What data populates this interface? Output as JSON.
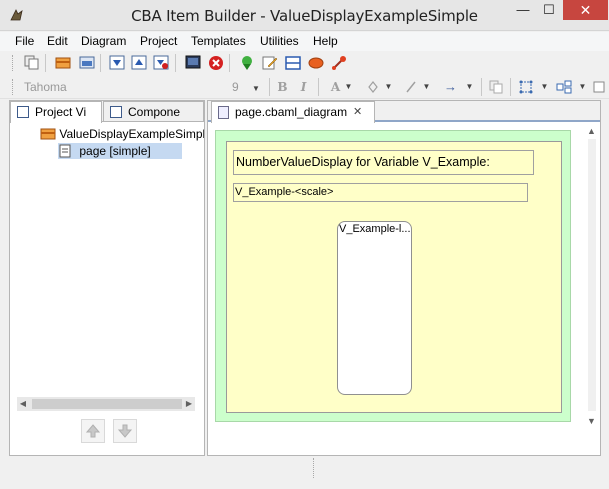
{
  "window": {
    "title": "CBA Item Builder - ValueDisplayExampleSimple",
    "minimize": "—",
    "maximize": "☐",
    "close": "✕"
  },
  "menu": {
    "items": [
      "File",
      "Edit",
      "Diagram",
      "Project",
      "Templates",
      "Utilities",
      "Help"
    ]
  },
  "format_toolbar": {
    "font_family": "Tahoma",
    "font_size": "9",
    "bold": "B",
    "italic": "I",
    "font_color": "A",
    "arrow": "→"
  },
  "left_panel": {
    "tabs": [
      {
        "label": "Project Vi",
        "active": true
      },
      {
        "label": "Compone",
        "active": false
      }
    ],
    "tree": [
      {
        "label": "ValueDisplayExampleSimple",
        "level": 0,
        "selected": false
      },
      {
        "label": "page [simple]",
        "level": 1,
        "selected": true
      }
    ]
  },
  "editor": {
    "tab_label": "page.cbaml_diagram",
    "tab_close": "✕",
    "diagram": {
      "title_text": "NumberValueDisplay for Variable V_Example:",
      "scale_text": "V_Example-<scale>",
      "display_text": "V_Example-l..."
    }
  },
  "colors": {
    "page_background": "#ccffcc",
    "panel_background": "#ffffc8",
    "close_button": "#c7463f",
    "selection": "#c5d9f1"
  }
}
